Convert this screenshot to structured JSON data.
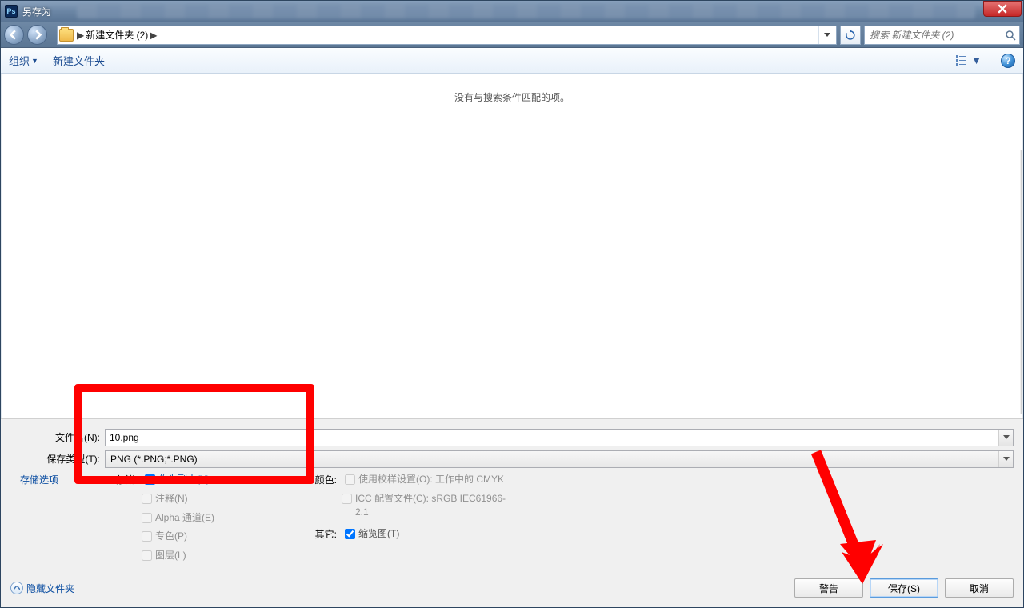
{
  "window": {
    "title": "另存为",
    "app_icon_text": "Ps"
  },
  "nav": {
    "crumb_root": "▶",
    "crumb_folder": "新建文件夹 (2)",
    "search_placeholder": "搜索 新建文件夹 (2)"
  },
  "toolbar": {
    "organize": "组织",
    "new_folder": "新建文件夹",
    "help_glyph": "?"
  },
  "pane": {
    "empty_msg": "没有与搜索条件匹配的项。"
  },
  "fields": {
    "filename_label": "文件名(N):",
    "filename_value": "10.png",
    "filetype_label": "保存类型(T):",
    "filetype_value": "PNG (*.PNG;*.PNG)"
  },
  "options": {
    "storage_link": "存储选项",
    "save_header": "存储:",
    "as_copy": "作为副本(Y)",
    "annotation": "注释(N)",
    "alpha": "Alpha 通道(E)",
    "spot": "专色(P)",
    "layers": "图层(L)",
    "color_header": "颜色:",
    "proof": "使用校样设置(O):  工作中的 CMYK",
    "icc": "ICC 配置文件(C): sRGB IEC61966-2.1",
    "other_header": "其它:",
    "thumbnail": "缩览图(T)"
  },
  "footer": {
    "hide_folders": "隐藏文件夹",
    "warn": "警告",
    "save": "保存(S)",
    "cancel": "取消"
  }
}
